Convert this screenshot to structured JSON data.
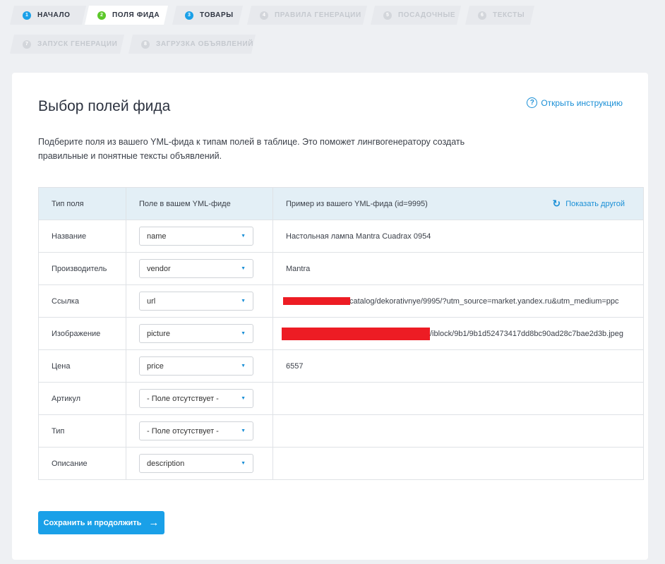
{
  "steps": [
    {
      "num": "1",
      "label": "НАЧАЛО"
    },
    {
      "num": "2",
      "label": "ПОЛЯ ФИДА"
    },
    {
      "num": "3",
      "label": "ТОВАРЫ"
    },
    {
      "num": "4",
      "label": "ПРАВИЛА ГЕНЕРАЦИИ"
    },
    {
      "num": "5",
      "label": "ПОСАДОЧНЫЕ"
    },
    {
      "num": "6",
      "label": "ТЕКСТЫ"
    },
    {
      "num": "7",
      "label": "ЗАПУСК ГЕНЕРАЦИИ"
    },
    {
      "num": "8",
      "label": "ЗАГРУЗКА ОБЪЯВЛЕНИЙ"
    }
  ],
  "page": {
    "title": "Выбор полей фида",
    "help_link": "Открыть инструкцию",
    "help_icon": "?",
    "intro": "Подберите поля из вашего YML-фида к типам полей в таблице. Это поможет лингвогенератору создать правильные и понятные тексты объявлений."
  },
  "table": {
    "headers": {
      "type": "Тип поля",
      "field": "Поле в вашем YML-фиде",
      "example": "Пример из вашего YML-фида (id=9995)",
      "refresh": "Показать другой"
    },
    "rows": [
      {
        "type": "Название",
        "field": "name",
        "example": "Настольная лампа Mantra Cuadrax 0954"
      },
      {
        "type": "Производитель",
        "field": "vendor",
        "example": "Mantra"
      },
      {
        "type": "Ссылка",
        "field": "url",
        "example": "catalog/dekorativnye/9995/?utm_source=market.yandex.ru&utm_medium=ppc"
      },
      {
        "type": "Изображение",
        "field": "picture",
        "example": "/iblock/9b1/9b1d52473417dd8bc90ad28c7bae2d3b.jpeg"
      },
      {
        "type": "Цена",
        "field": "price",
        "example": "6557"
      },
      {
        "type": "Артикул",
        "field": "- Поле отсутствует -",
        "example": ""
      },
      {
        "type": "Тип",
        "field": "- Поле отсутствует -",
        "example": ""
      },
      {
        "type": "Описание",
        "field": "description",
        "example": ""
      }
    ]
  },
  "save_button": "Сохранить и продолжить",
  "colors": {
    "accent": "#1aa0e8",
    "active_step": "#5cc82a",
    "header_bg": "#e3eff6",
    "redaction": "#ed1c24"
  }
}
